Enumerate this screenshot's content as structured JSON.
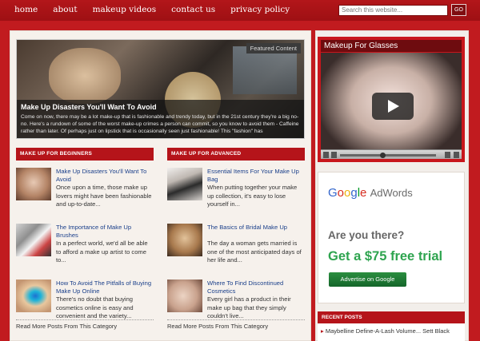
{
  "nav": {
    "items": [
      "home",
      "about",
      "makeup videos",
      "contact us",
      "privacy policy"
    ]
  },
  "search": {
    "placeholder": "Search this website...",
    "button_label": "GO"
  },
  "featured": {
    "tag": "Featured Content",
    "title": "Make Up Disasters You'll Want To Avoid",
    "excerpt": "Come on now, there may be a lot make-up that is fashionable and trendy today, but in the 21st century they're a big no-no. Here's a rundown of some of the worst make-up crimes a person can commit, so you know to avoid them - Caffeine rather than later. Of perhaps just on lipstick that is occasionally seen just fashionable! This \"fashion\" has"
  },
  "columns": [
    {
      "heading": "MAKE UP FOR BEGINNERS",
      "posts": [
        {
          "title": "Make Up Disasters You'll Want To Avoid",
          "body": "Once upon a time, those make up lovers might have been fashionable and up-to-date..."
        },
        {
          "title": "The Importance of Make Up Brushes",
          "body": "In a perfect world, we'd all be able to afford a make up artist to come to..."
        },
        {
          "title": "How To Avoid The Pitfalls of Buying Make Up Online",
          "body": "There's no doubt that buying cosmetics online is easy and convenient and the variety..."
        }
      ],
      "read_more": "Read More Posts From This Category"
    },
    {
      "heading": "MAKE UP FOR ADVANCED",
      "posts": [
        {
          "title": "Essential Items For Your Make Up Bag",
          "body": "When putting together your make up collection, it's easy to lose yourself in..."
        },
        {
          "title": "The Basics of Bridal Make Up",
          "body": "The day a woman gets married is one of the most anticipated days of her life and..."
        },
        {
          "title": "Where To Find Discontinued Cosmetics",
          "body": "Every girl has a product in their make up bag that they simply couldn't live..."
        }
      ],
      "read_more": "Read More Posts From This Category"
    }
  ],
  "video": {
    "title": "Makeup For Glasses"
  },
  "ad": {
    "logo_google": [
      "G",
      "o",
      "o",
      "g",
      "l",
      "e"
    ],
    "logo_suffix": "AdWords",
    "question": "Are you there?",
    "offer": "Get a $75 free trial",
    "button": "Advertise on Google"
  },
  "recent": {
    "heading": "RECENT POSTS",
    "items": [
      "Maybelline Define-A-Lash Volume... Sett Black"
    ]
  },
  "colors": {
    "brand_red": "#c11b1f",
    "header_red": "#b5141a",
    "offer_green": "#2ea44f"
  }
}
